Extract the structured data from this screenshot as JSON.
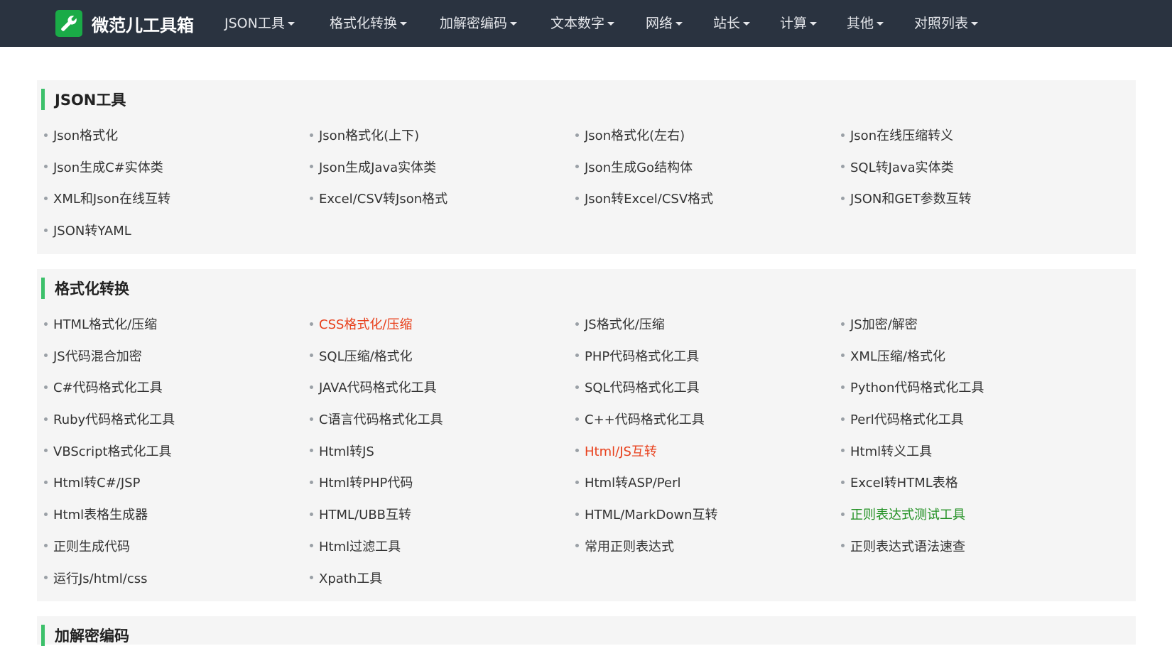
{
  "brand": {
    "name": "微范儿工具箱",
    "logo_icon": "wrench-icon",
    "logo_color": "#1aab47"
  },
  "nav": [
    {
      "label": "JSON工具"
    },
    {
      "label": "格式化转换"
    },
    {
      "label": "加解密编码"
    },
    {
      "label": "文本数字"
    },
    {
      "label": "网络"
    },
    {
      "label": "站长"
    },
    {
      "label": "计算"
    },
    {
      "label": "其他"
    },
    {
      "label": "对照列表"
    }
  ],
  "sections": [
    {
      "title": "JSON工具",
      "tools": [
        {
          "label": "Json格式化"
        },
        {
          "label": " Json格式化(上下)"
        },
        {
          "label": "Json格式化(左右)"
        },
        {
          "label": "Json在线压缩转义"
        },
        {
          "label": "Json生成C#实体类"
        },
        {
          "label": " Json生成Java实体类"
        },
        {
          "label": "Json生成Go结构体"
        },
        {
          "label": "SQL转Java实体类"
        },
        {
          "label": "XML和Json在线互转"
        },
        {
          "label": "Excel/CSV转Json格式"
        },
        {
          "label": "Json转Excel/CSV格式"
        },
        {
          "label": "JSON和GET参数互转"
        },
        {
          "label": "JSON转YAML"
        }
      ]
    },
    {
      "title": "格式化转换",
      "tools": [
        {
          "label": "HTML格式化/压缩"
        },
        {
          "label": " CSS格式化/压缩",
          "highlight": "red"
        },
        {
          "label": "JS格式化/压缩"
        },
        {
          "label": "JS加密/解密"
        },
        {
          "label": " JS代码混合加密"
        },
        {
          "label": "SQL压缩/格式化"
        },
        {
          "label": "PHP代码格式化工具"
        },
        {
          "label": "XML压缩/格式化"
        },
        {
          "label": "C#代码格式化工具"
        },
        {
          "label": "JAVA代码格式化工具"
        },
        {
          "label": "SQL代码格式化工具"
        },
        {
          "label": "Python代码格式化工具"
        },
        {
          "label": "Ruby代码格式化工具"
        },
        {
          "label": "C语言代码格式化工具"
        },
        {
          "label": "C++代码格式化工具"
        },
        {
          "label": "Perl代码格式化工具"
        },
        {
          "label": "VBScript格式化工具"
        },
        {
          "label": " Html转JS"
        },
        {
          "label": "Html/JS互转",
          "highlight": "red"
        },
        {
          "label": " Html转义工具"
        },
        {
          "label": " Html转C#/JSP"
        },
        {
          "label": "Html转PHP代码"
        },
        {
          "label": "Html转ASP/Perl"
        },
        {
          "label": "Excel转HTML表格"
        },
        {
          "label": "Html表格生成器"
        },
        {
          "label": "HTML/UBB互转"
        },
        {
          "label": "HTML/MarkDown互转"
        },
        {
          "label": "正则表达式测试工具",
          "highlight": "green"
        },
        {
          "label": "正则生成代码"
        },
        {
          "label": "Html过滤工具"
        },
        {
          "label": "常用正则表达式"
        },
        {
          "label": "正则表达式语法速查"
        },
        {
          "label": "运行Js/html/css"
        },
        {
          "label": "Xpath工具"
        }
      ]
    },
    {
      "title": "加解密编码",
      "tools": []
    }
  ],
  "colors": {
    "navbar": "#2a3340",
    "panel": "#f5f5f5",
    "accent_bar": "#3cc06a",
    "link": "#333333",
    "highlight_red": "#e8401c",
    "highlight_green": "#229124"
  }
}
